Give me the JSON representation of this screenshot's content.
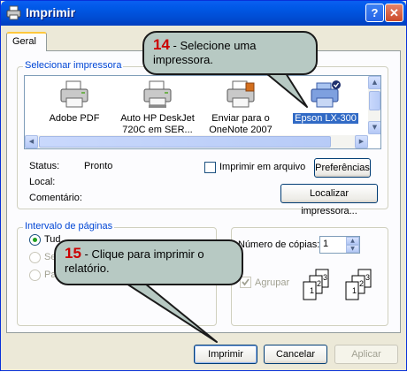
{
  "window": {
    "title": "Imprimir",
    "help_glyph": "?",
    "close_glyph": "✕"
  },
  "tabs": [
    {
      "label": "Geral",
      "active": true
    }
  ],
  "select_printer": {
    "legend": "Selecionar impressora",
    "printers": [
      {
        "name_lines": [
          "Adobe PDF"
        ],
        "icon": "printer-icon",
        "selected": false
      },
      {
        "name_lines": [
          "Auto HP DeskJet",
          "720C em SER..."
        ],
        "icon": "network-printer-icon",
        "selected": false
      },
      {
        "name_lines": [
          "Enviar para o",
          "OneNote 2007"
        ],
        "icon": "printer-icon",
        "selected": false
      },
      {
        "name_lines": [
          "Epson LX-300"
        ],
        "icon": "default-printer-icon",
        "selected": true
      }
    ],
    "status_label": "Status:",
    "status_value": "Pronto",
    "location_label": "Local:",
    "comment_label": "Comentário:",
    "print_to_file": "Imprimir em arquivo",
    "preferences_button": "Preferências",
    "find_printer_button": "Localizar impressora..."
  },
  "page_range": {
    "legend": "Intervalo de páginas",
    "options": [
      {
        "label": "Tud",
        "checked": true,
        "enabled": true
      },
      {
        "label": "Se",
        "checked": false,
        "enabled": false
      },
      {
        "label": "Pa",
        "checked": false,
        "enabled": false
      }
    ]
  },
  "copies": {
    "label": "Número de cópias:",
    "value": "1",
    "collate_label": "Agrupar",
    "collate_checked": true,
    "collate_enabled": false,
    "collate_pages": [
      "1",
      "2",
      "3"
    ]
  },
  "buttons": {
    "print": "Imprimir",
    "cancel": "Cancelar",
    "apply": "Aplicar"
  },
  "callouts": [
    {
      "number": "14",
      "text": "- Selecione uma impressora."
    },
    {
      "number": "15",
      "text": "- Clique para imprimir o relatório."
    }
  ],
  "colors": {
    "title_bar": "#0054e3",
    "selection": "#316ac5",
    "callout_bg": "#b7c9c3",
    "callout_number": "#cc0000"
  }
}
